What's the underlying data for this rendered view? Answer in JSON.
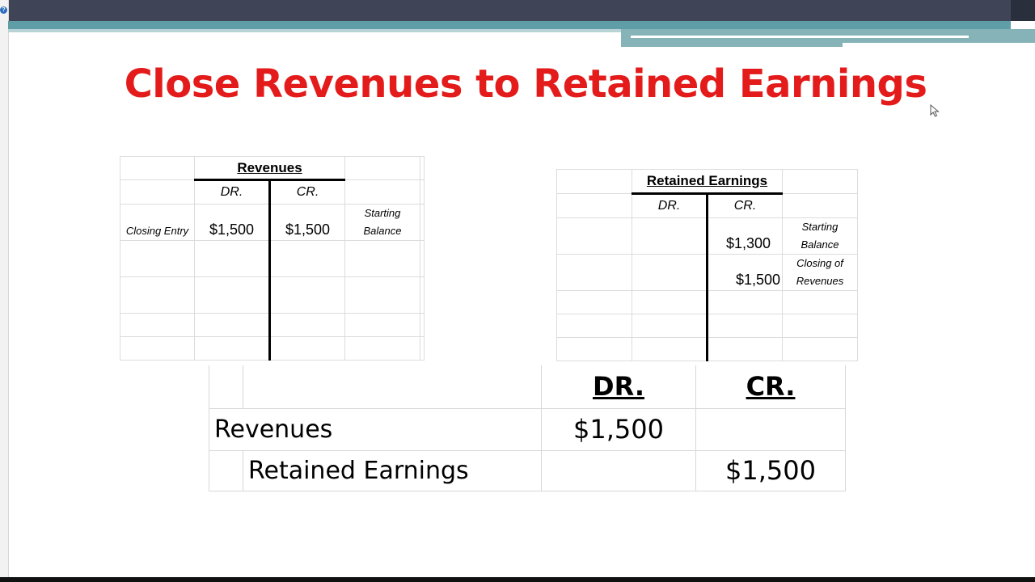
{
  "slide": {
    "title": "Close Revenues to Retained Earnings",
    "title_color": "#e31b1b"
  },
  "revenues_account": {
    "title": "Revenues",
    "dr_label": "DR.",
    "cr_label": "CR.",
    "row_label": "Closing Entry",
    "debit": "$1,500",
    "credit": "$1,500",
    "note_line1": "Starting",
    "note_line2": "Balance"
  },
  "retained_earnings_account": {
    "title": "Retained Earnings",
    "dr_label": "DR.",
    "cr_label": "CR.",
    "entries": [
      {
        "credit": "$1,300",
        "note_line1": "Starting",
        "note_line2": "Balance"
      },
      {
        "credit": "$1,500",
        "note_line1": "Closing of",
        "note_line2": "Revenues"
      }
    ]
  },
  "journal_entry": {
    "dr_header": "DR.",
    "cr_header": "CR.",
    "debit_account": "Revenues",
    "debit_amount": "$1,500",
    "credit_account": "Retained Earnings",
    "credit_amount": "$1,500"
  },
  "icons": {
    "left_rail": "help-icon",
    "pointer": "mouse-pointer-icon"
  }
}
